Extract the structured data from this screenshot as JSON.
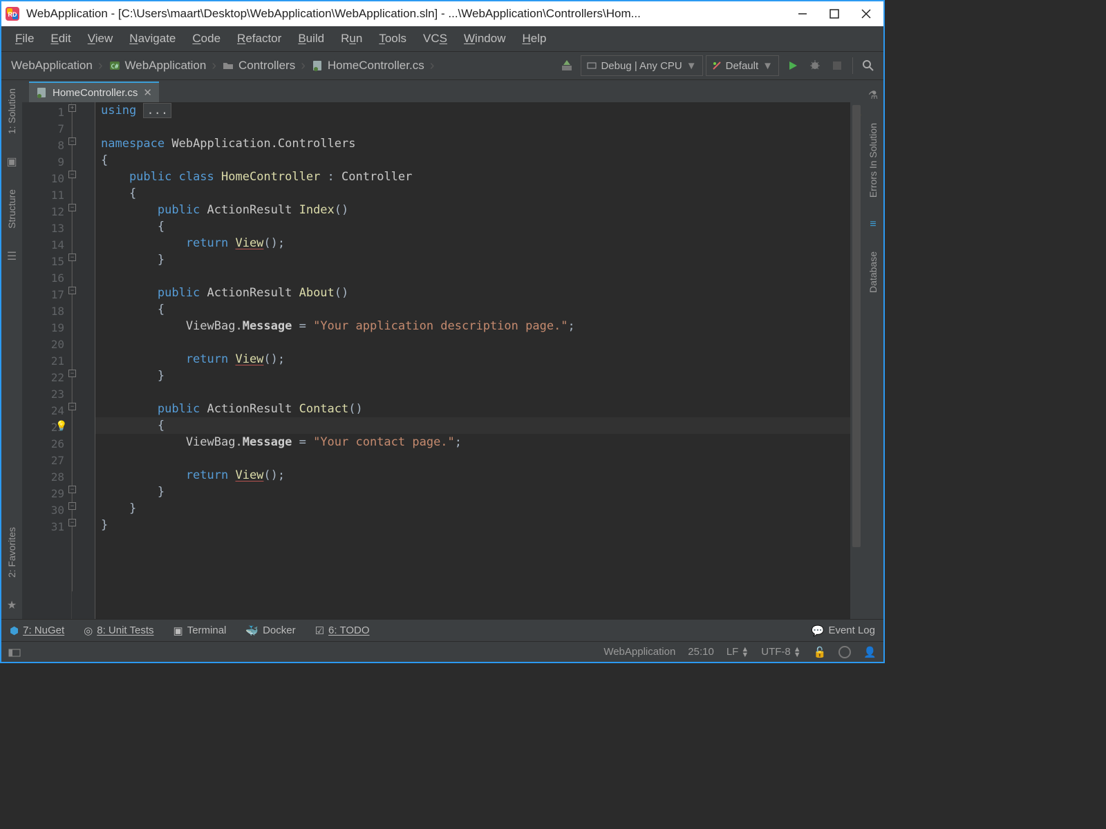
{
  "title": "WebApplication - [C:\\Users\\maart\\Desktop\\WebApplication\\WebApplication.sln] - ...\\WebApplication\\Controllers\\Hom...",
  "menu": [
    "File",
    "Edit",
    "View",
    "Navigate",
    "Code",
    "Refactor",
    "Build",
    "Run",
    "Tools",
    "VCS",
    "Window",
    "Help"
  ],
  "breadcrumbs": [
    "WebApplication",
    "WebApplication",
    "Controllers",
    "HomeController.cs"
  ],
  "run_config": "Debug | Any CPU",
  "target": "Default",
  "tab": {
    "name": "HomeController.cs"
  },
  "left_tools": [
    "1: Solution",
    "Structure",
    "2: Favorites"
  ],
  "right_tools": [
    "Errors In Solution",
    "Database"
  ],
  "line_numbers": [
    "1",
    "7",
    "8",
    "9",
    "10",
    "11",
    "12",
    "13",
    "14",
    "15",
    "16",
    "17",
    "18",
    "19",
    "20",
    "21",
    "22",
    "23",
    "24",
    "25",
    "26",
    "27",
    "28",
    "29",
    "30",
    "31"
  ],
  "code": {
    "l1a": "using ",
    "l1b": "...",
    "l3a": "namespace ",
    "l3b": "WebApplication.Controllers",
    "l4": "{",
    "l5a": "    public ",
    "l5b": "class ",
    "l5c": "HomeController ",
    "l5d": ": ",
    "l5e": "Controller",
    "l6": "    {",
    "l7a": "        public ",
    "l7b": "ActionResult ",
    "l7c": "Index",
    "l7d": "()",
    "l8": "        {",
    "l9a": "            return ",
    "l9b": "View",
    "l9c": "();",
    "l10": "        }",
    "l12a": "        public ",
    "l12b": "ActionResult ",
    "l12c": "About",
    "l12d": "()",
    "l13": "        {",
    "l14a": "            ViewBag.",
    "l14b": "Message ",
    "l14c": "= ",
    "l14d": "\"Your application description page.\"",
    "l14e": ";",
    "l16a": "            return ",
    "l16b": "View",
    "l16c": "();",
    "l17": "        }",
    "l19a": "        public ",
    "l19b": "ActionResult ",
    "l19c": "Contact",
    "l19d": "()",
    "l20": "        {",
    "l21a": "            ViewBag.",
    "l21b": "Message ",
    "l21c": "= ",
    "l21d": "\"Your contact page.\"",
    "l21e": ";",
    "l23a": "            return ",
    "l23b": "View",
    "l23c": "();",
    "l24": "        }",
    "l25": "    }",
    "l26": "}"
  },
  "bottom_tools": {
    "nuget": "7: NuGet",
    "ut": "8: Unit Tests",
    "term": "Terminal",
    "docker": "Docker",
    "todo": "6: TODO",
    "eventlog": "Event Log"
  },
  "status": {
    "context": "WebApplication",
    "pos": "25:10",
    "le": "LF",
    "enc": "UTF-8"
  }
}
